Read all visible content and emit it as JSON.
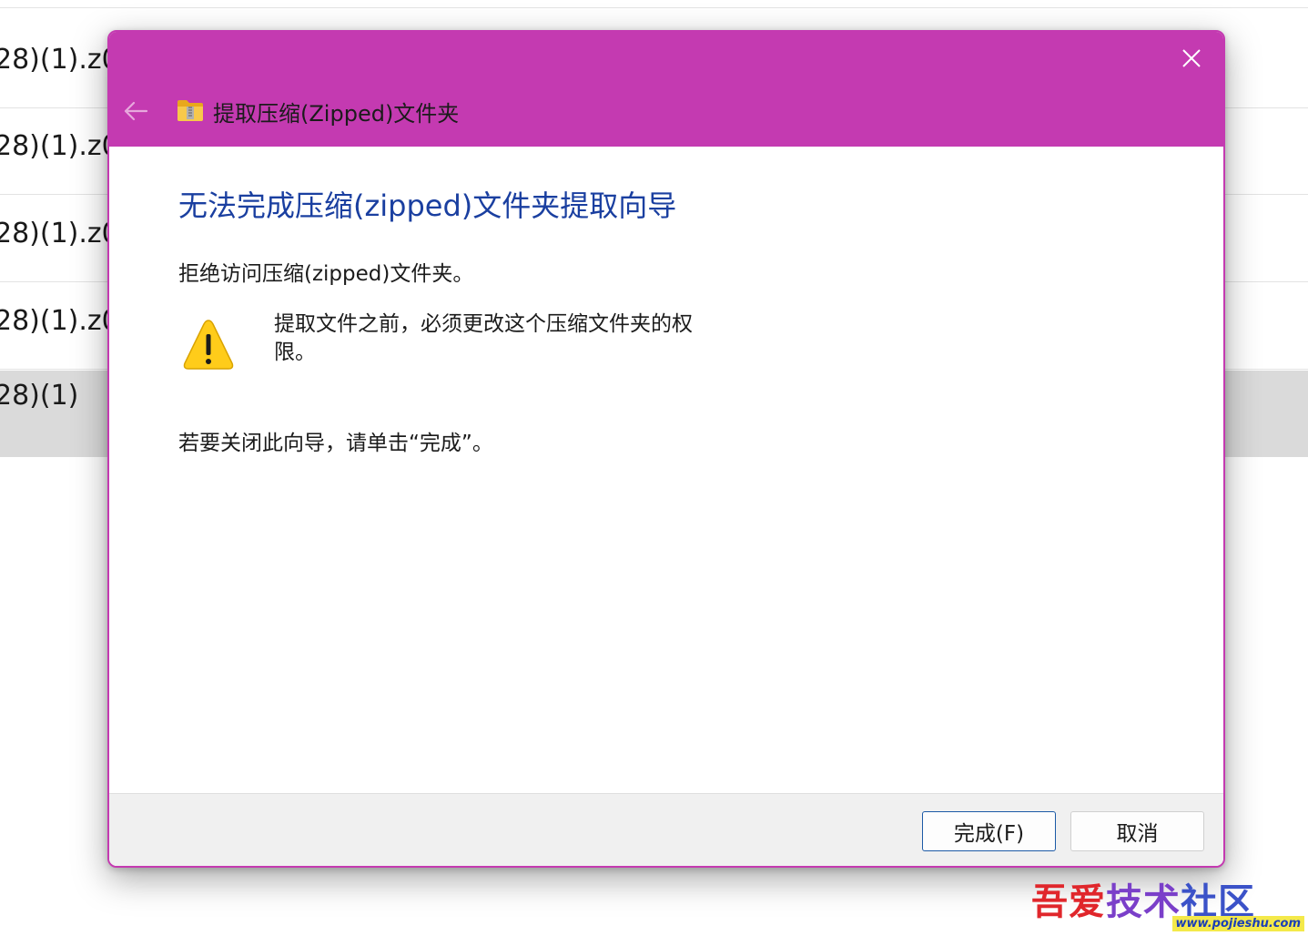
{
  "background": {
    "rows": [
      {
        "text": "28)(1).z01"
      },
      {
        "text": "28)(1).z02"
      },
      {
        "text": "28)(1).z03"
      },
      {
        "text": "28)(1).z04"
      },
      {
        "text": "28)(1)"
      }
    ]
  },
  "dialog": {
    "title": "提取压缩(Zipped)文件夹",
    "heading": "无法完成压缩(zipped)文件夹提取向导",
    "description": "拒绝访问压缩(zipped)文件夹。",
    "warning_message": "提取文件之前，必须更改这个压缩文件夹的权限。",
    "hint": "若要关闭此向导，请单击“完成”。",
    "buttons": {
      "finish": "完成(F)",
      "cancel": "取消"
    },
    "icons": {
      "close": "close-icon",
      "back": "back-arrow-icon",
      "folder": "zipped-folder-icon",
      "warning": "warning-icon"
    },
    "colors": {
      "titlebar": "#c43ab1",
      "heading": "#1a3fa0",
      "primary_button_border": "#1c5aa6"
    }
  },
  "watermark": {
    "title": "吾爱技术社区",
    "url": "www.pojieshu.com"
  }
}
